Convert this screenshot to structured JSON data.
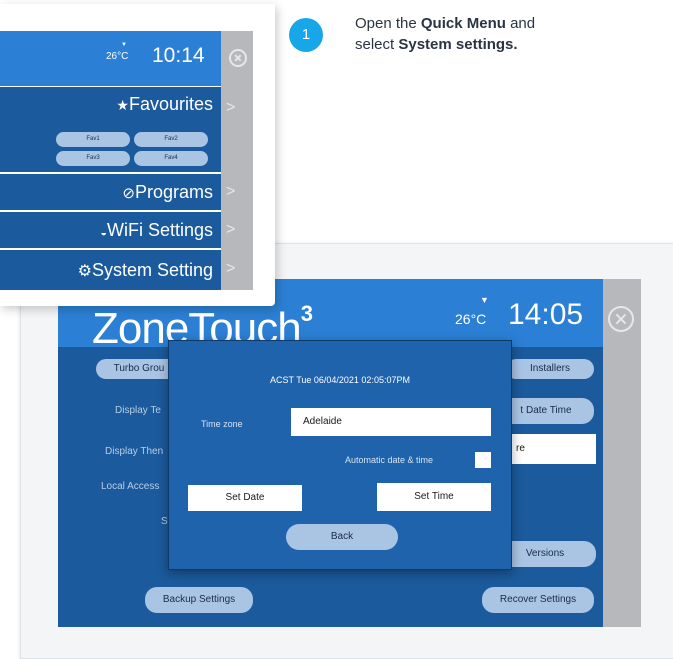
{
  "instruction": {
    "step_number": "1",
    "line1_prefix": "Open the ",
    "quick_menu": "Quick Menu",
    "line1_suffix": " and",
    "line2_prefix": "select ",
    "system_settings": "System settings."
  },
  "quick_menu": {
    "temperature": "26°C",
    "time": "10:14",
    "favourites_label": "Favourites",
    "favourites": [
      "Fav1",
      "Fav2",
      "Fav3",
      "Fav4"
    ],
    "programs_label": "Programs",
    "wifi_label": "WiFi Settings",
    "system_label": "System Setting",
    "chevron": ">"
  },
  "system_screen": {
    "logo_main": "ZoneTouch",
    "logo_super": "3",
    "temperature": "26°C",
    "time": "14:05",
    "turbo_button": "Turbo Grou",
    "installers_button": "Installers",
    "date_time_button": "t Date Time",
    "side_field_value": "re",
    "display_te_label": "Display Te",
    "display_then_label": "Display Then",
    "local_access_label": "Local Access",
    "s_label": "S",
    "versions_button": "Versions",
    "backup_button": "Backup Settings",
    "recover_button": "Recover Settings"
  },
  "dialog": {
    "datetime": "ACST Tue 06/04/2021 02:05:07PM",
    "timezone_label": "Time zone",
    "timezone_value": "Adelaide",
    "auto_label": "Automatic date & time",
    "auto_checked": false,
    "set_date_button": "Set Date",
    "set_time_button": "Set Time",
    "back_button": "Back"
  },
  "colors": {
    "panel_blue": "#1b5a9c",
    "header_blue": "#2b7fd4",
    "pill": "#aac4e4",
    "badge_cyan": "#17a6e8",
    "side_grey": "#b6b8bb"
  }
}
